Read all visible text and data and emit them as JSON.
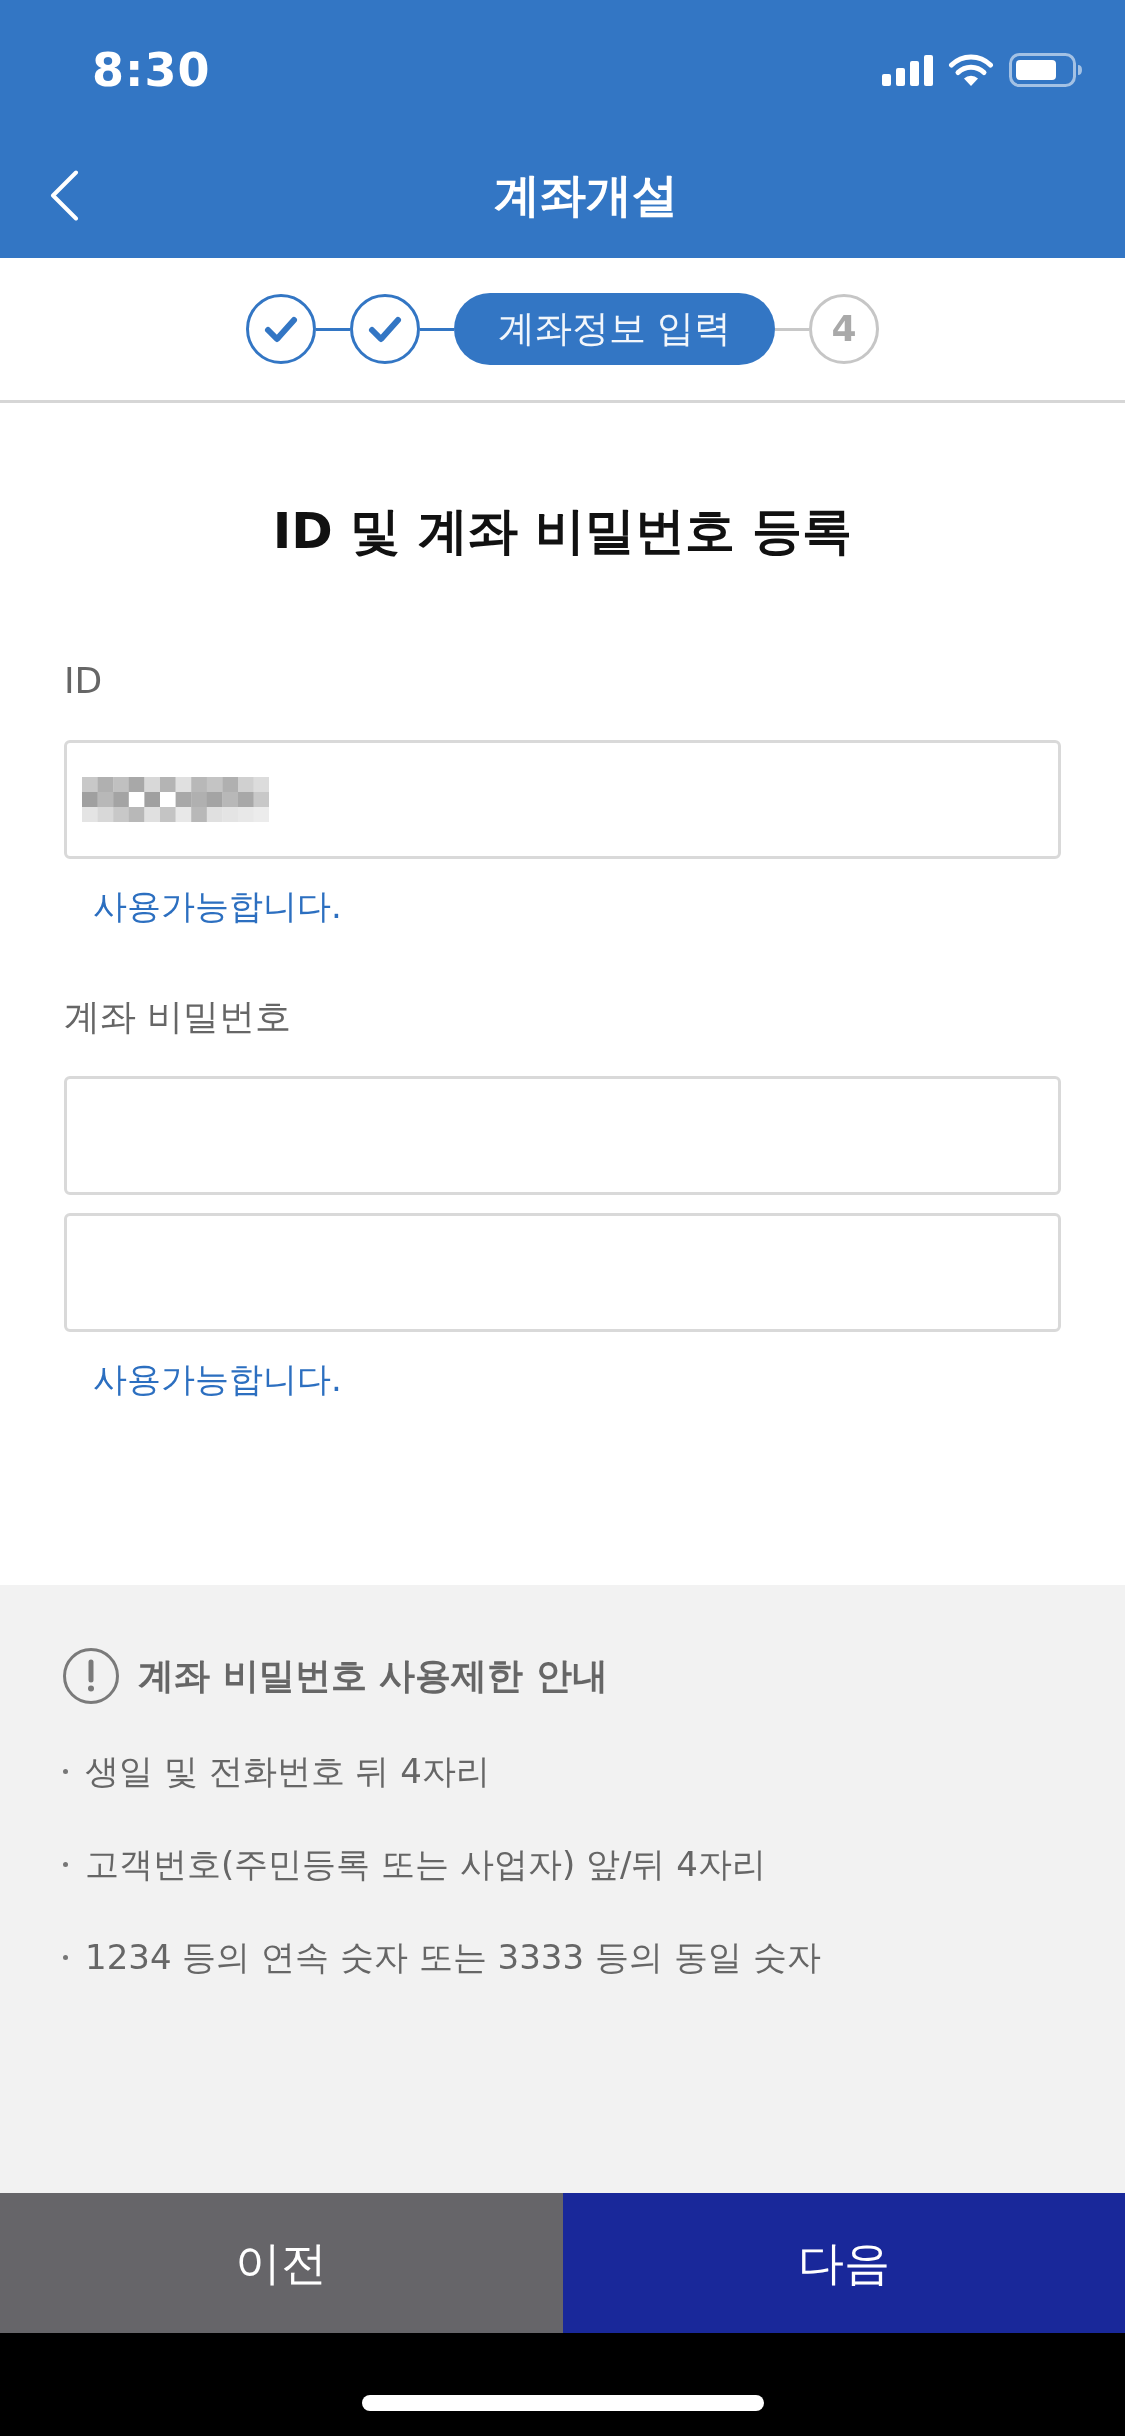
{
  "status_bar": {
    "time": "8:30"
  },
  "header": {
    "title": "계좌개설"
  },
  "steps": [
    {
      "kind": "done"
    },
    {
      "kind": "done"
    },
    {
      "kind": "current",
      "label": "계좌정보 입력"
    },
    {
      "kind": "pending",
      "label": "4"
    }
  ],
  "form": {
    "heading": "ID 및 계좌 비밀번호 등록",
    "groups": [
      {
        "label": "ID",
        "inputs": [
          {
            "kind": "redacted"
          }
        ],
        "message": {
          "text": "사용가능합니다.",
          "kind": "success"
        }
      },
      {
        "label": "계좌 비밀번호",
        "inputs": [
          {
            "kind": "empty"
          },
          {
            "kind": "empty"
          }
        ],
        "message": {
          "text": "사용가능합니다.",
          "kind": "success"
        }
      }
    ]
  },
  "notice": {
    "title": "계좌 비밀번호 사용제한 안내",
    "items": [
      "생일 및 전화번호 뒤 4자리",
      "고객번호(주민등록 또는 사업자) 앞/뒤 4자리",
      "1234 등의 연속 숫자 또는 3333 등의 동일 숫자"
    ]
  },
  "footer_buttons": [
    {
      "label": "이전",
      "kind": "secondary"
    },
    {
      "label": "다음",
      "kind": "primary"
    }
  ]
}
